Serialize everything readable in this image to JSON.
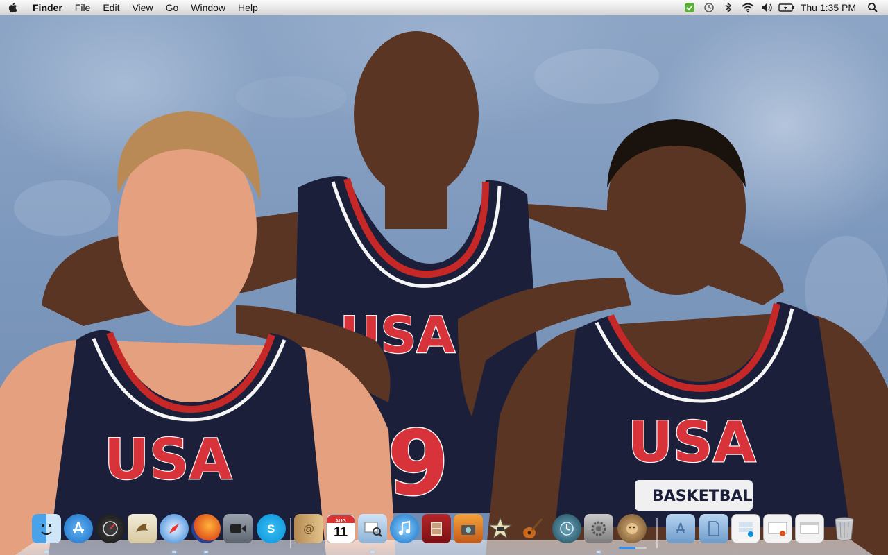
{
  "menubar": {
    "app_name": "Finder",
    "items": [
      "File",
      "Edit",
      "View",
      "Go",
      "Window",
      "Help"
    ],
    "clock": "Thu 1:35 PM",
    "status_icons": [
      "evernote-icon",
      "time-machine-icon",
      "bluetooth-icon",
      "wifi-icon",
      "volume-icon",
      "battery-icon",
      "spotlight-icon"
    ]
  },
  "wallpaper": {
    "jersey_text": "USA",
    "jersey_subtext": "BASKETBALL",
    "jersey_number": "9"
  },
  "dock": {
    "calendar_day": "11",
    "calendar_month": "AUG",
    "items": [
      "finder",
      "app-store",
      "dashboard",
      "mail",
      "safari",
      "firefox",
      "facetime",
      "skype",
      "address-book",
      "ical",
      "iphoto-preview",
      "itunes",
      "photo-booth",
      "image-capture",
      "imovie",
      "garageband",
      "time-machine",
      "system-preferences",
      "lion-installer",
      "applications-folder",
      "documents-folder",
      "downloads-stack",
      "minimized-firefox",
      "minimized-window",
      "trash"
    ]
  },
  "colors": {
    "menubar_bg": "#e6e6e6",
    "jersey_navy": "#1c1f3a",
    "jersey_red": "#c62828"
  }
}
